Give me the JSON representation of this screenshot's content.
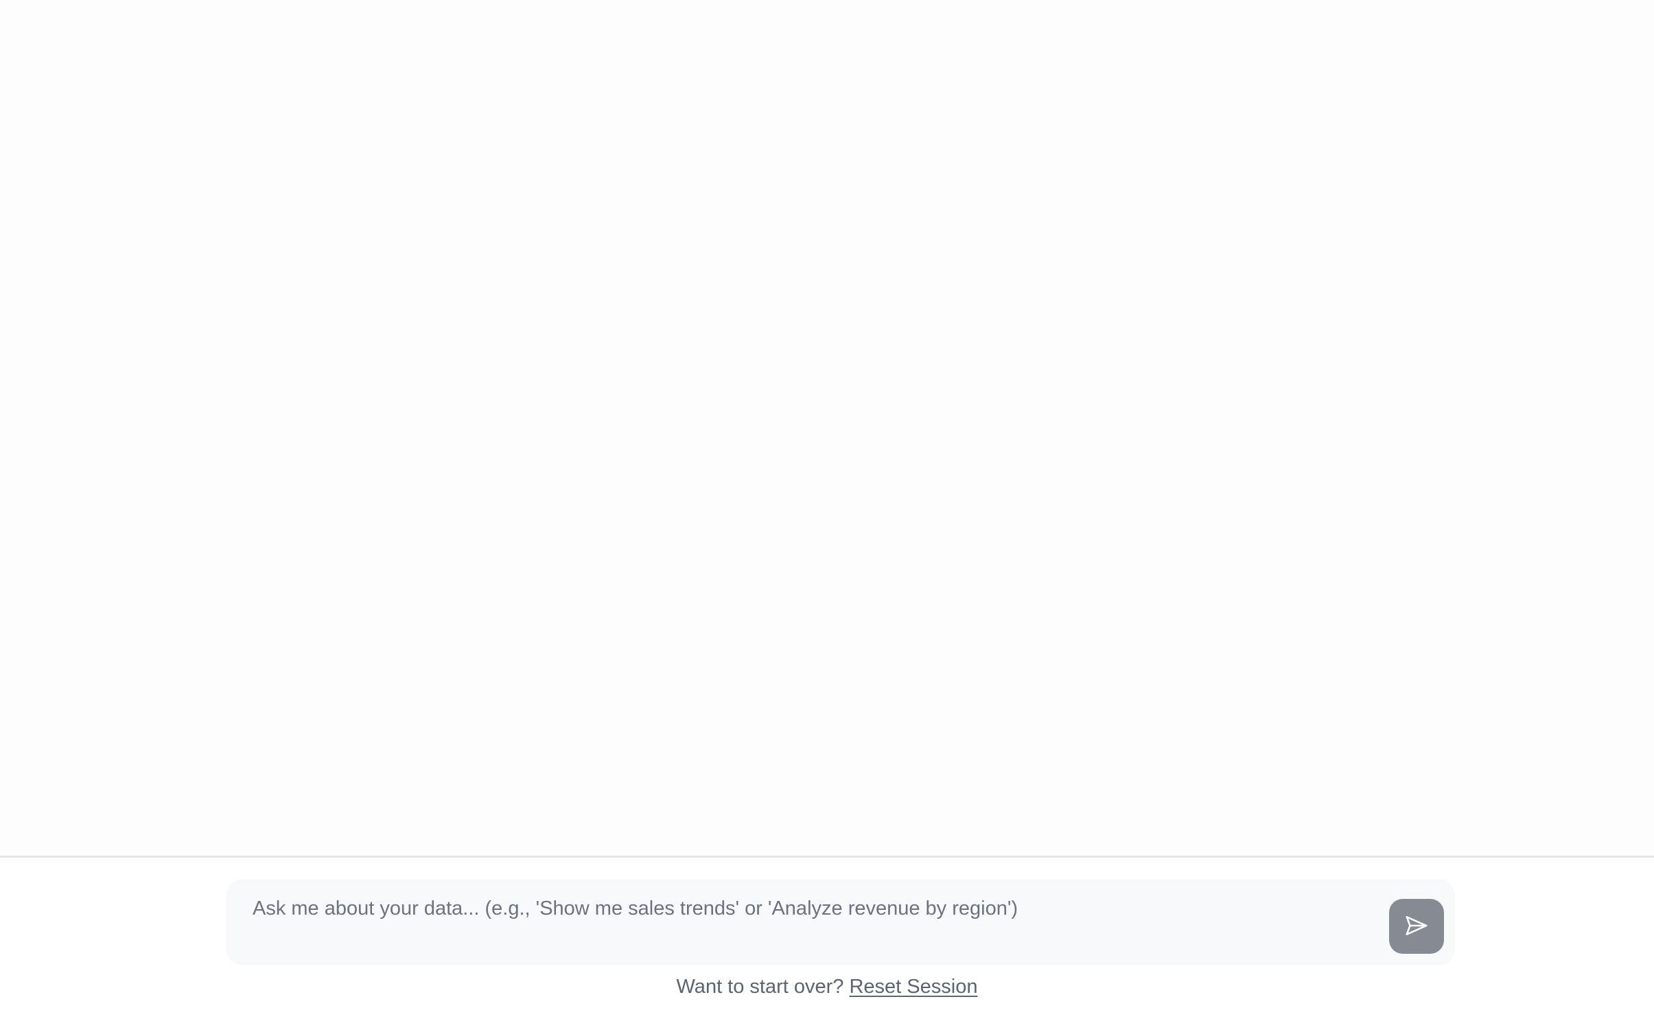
{
  "composer": {
    "input_placeholder": "Ask me about your data... (e.g., 'Show me sales trends' or 'Analyze revenue by region')",
    "input_value": "",
    "send_icon": "send-icon"
  },
  "footer": {
    "prompt_text": "Want to start over?",
    "reset_label": "Reset Session"
  },
  "colors": {
    "send_button_bg": "#858a93",
    "input_bg": "#f8f9fb",
    "text_muted": "#5b6474",
    "divider": "#e4e5e8"
  }
}
